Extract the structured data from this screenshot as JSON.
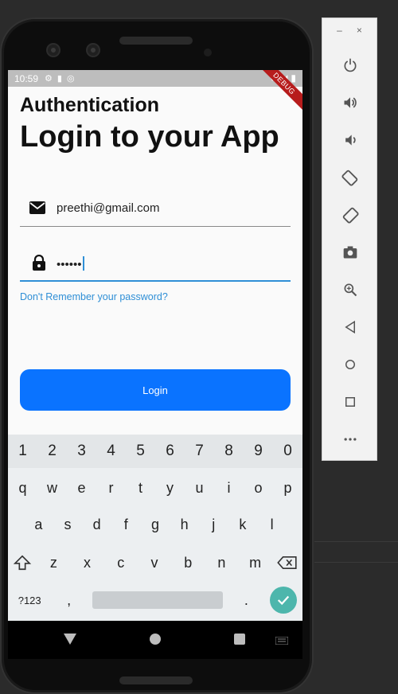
{
  "status_bar": {
    "time": "10:59",
    "debug_banner": "DEBUG"
  },
  "auth": {
    "subtitle": "Authentication",
    "title": "Login to your App",
    "email_value": "preethi@gmail.com",
    "password_value": "••••••",
    "forgot_link": "Don't Remember your password?",
    "login_button": "Login"
  },
  "keyboard": {
    "numbers": [
      "1",
      "2",
      "3",
      "4",
      "5",
      "6",
      "7",
      "8",
      "9",
      "0"
    ],
    "row1": [
      "q",
      "w",
      "e",
      "r",
      "t",
      "y",
      "u",
      "i",
      "o",
      "p"
    ],
    "row2": [
      "a",
      "s",
      "d",
      "f",
      "g",
      "h",
      "j",
      "k",
      "l"
    ],
    "row3": [
      "z",
      "x",
      "c",
      "v",
      "b",
      "n",
      "m"
    ],
    "symbols_key": "?123",
    "comma_key": ",",
    "period_key": "."
  },
  "emulator_panel": {
    "minimize": "–",
    "close": "×",
    "buttons": [
      "power-icon",
      "volume-up-icon",
      "volume-down-icon",
      "rotate-left-icon",
      "rotate-right-icon",
      "camera-icon",
      "zoom-icon",
      "back-icon",
      "home-icon",
      "overview-icon",
      "more-icon"
    ]
  },
  "colors": {
    "accent": "#2f8fd6",
    "button": "#0a73ff",
    "enter_key": "#4db6ac",
    "debug": "#b71c1c"
  }
}
